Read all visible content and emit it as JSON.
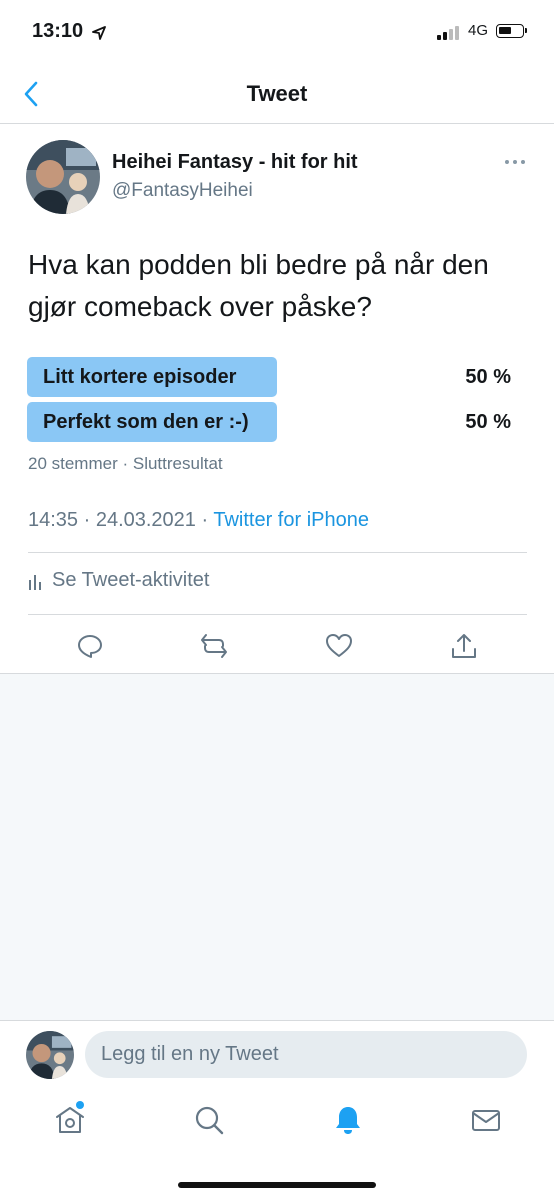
{
  "status": {
    "time": "13:10",
    "network": "4G"
  },
  "nav": {
    "title": "Tweet"
  },
  "tweet": {
    "author_name": "Heihei Fantasy - hit for hit",
    "author_handle": "@FantasyHeihei",
    "text": "Hva kan podden bli bedre på når den gjør comeback over påske?",
    "poll": {
      "options": [
        {
          "label": "Litt kortere episoder",
          "percent": "50 %"
        },
        {
          "label": "Perfekt som den er :-)",
          "percent": "50 %"
        }
      ],
      "meta": "20 stemmer · Sluttresultat"
    },
    "timestamp": "14:35 · 24.03.2021 · ",
    "source": "Twitter for iPhone",
    "activity_label": "Se Tweet-aktivitet"
  },
  "composer": {
    "placeholder": "Legg til en ny Tweet"
  },
  "colors": {
    "accent": "#1da1f2",
    "poll_bar": "#8ac7f5",
    "secondary_text": "#657786"
  }
}
